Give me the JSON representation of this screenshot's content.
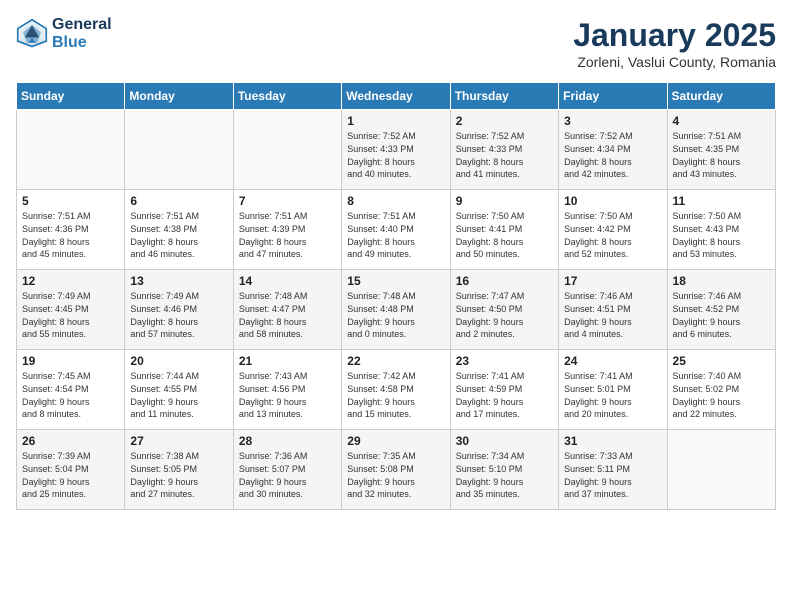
{
  "header": {
    "logo_line1": "General",
    "logo_line2": "Blue",
    "title": "January 2025",
    "subtitle": "Zorleni, Vaslui County, Romania"
  },
  "days_of_week": [
    "Sunday",
    "Monday",
    "Tuesday",
    "Wednesday",
    "Thursday",
    "Friday",
    "Saturday"
  ],
  "weeks": [
    [
      {
        "day": "",
        "info": ""
      },
      {
        "day": "",
        "info": ""
      },
      {
        "day": "",
        "info": ""
      },
      {
        "day": "1",
        "info": "Sunrise: 7:52 AM\nSunset: 4:33 PM\nDaylight: 8 hours\nand 40 minutes."
      },
      {
        "day": "2",
        "info": "Sunrise: 7:52 AM\nSunset: 4:33 PM\nDaylight: 8 hours\nand 41 minutes."
      },
      {
        "day": "3",
        "info": "Sunrise: 7:52 AM\nSunset: 4:34 PM\nDaylight: 8 hours\nand 42 minutes."
      },
      {
        "day": "4",
        "info": "Sunrise: 7:51 AM\nSunset: 4:35 PM\nDaylight: 8 hours\nand 43 minutes."
      }
    ],
    [
      {
        "day": "5",
        "info": "Sunrise: 7:51 AM\nSunset: 4:36 PM\nDaylight: 8 hours\nand 45 minutes."
      },
      {
        "day": "6",
        "info": "Sunrise: 7:51 AM\nSunset: 4:38 PM\nDaylight: 8 hours\nand 46 minutes."
      },
      {
        "day": "7",
        "info": "Sunrise: 7:51 AM\nSunset: 4:39 PM\nDaylight: 8 hours\nand 47 minutes."
      },
      {
        "day": "8",
        "info": "Sunrise: 7:51 AM\nSunset: 4:40 PM\nDaylight: 8 hours\nand 49 minutes."
      },
      {
        "day": "9",
        "info": "Sunrise: 7:50 AM\nSunset: 4:41 PM\nDaylight: 8 hours\nand 50 minutes."
      },
      {
        "day": "10",
        "info": "Sunrise: 7:50 AM\nSunset: 4:42 PM\nDaylight: 8 hours\nand 52 minutes."
      },
      {
        "day": "11",
        "info": "Sunrise: 7:50 AM\nSunset: 4:43 PM\nDaylight: 8 hours\nand 53 minutes."
      }
    ],
    [
      {
        "day": "12",
        "info": "Sunrise: 7:49 AM\nSunset: 4:45 PM\nDaylight: 8 hours\nand 55 minutes."
      },
      {
        "day": "13",
        "info": "Sunrise: 7:49 AM\nSunset: 4:46 PM\nDaylight: 8 hours\nand 57 minutes."
      },
      {
        "day": "14",
        "info": "Sunrise: 7:48 AM\nSunset: 4:47 PM\nDaylight: 8 hours\nand 58 minutes."
      },
      {
        "day": "15",
        "info": "Sunrise: 7:48 AM\nSunset: 4:48 PM\nDaylight: 9 hours\nand 0 minutes."
      },
      {
        "day": "16",
        "info": "Sunrise: 7:47 AM\nSunset: 4:50 PM\nDaylight: 9 hours\nand 2 minutes."
      },
      {
        "day": "17",
        "info": "Sunrise: 7:46 AM\nSunset: 4:51 PM\nDaylight: 9 hours\nand 4 minutes."
      },
      {
        "day": "18",
        "info": "Sunrise: 7:46 AM\nSunset: 4:52 PM\nDaylight: 9 hours\nand 6 minutes."
      }
    ],
    [
      {
        "day": "19",
        "info": "Sunrise: 7:45 AM\nSunset: 4:54 PM\nDaylight: 9 hours\nand 8 minutes."
      },
      {
        "day": "20",
        "info": "Sunrise: 7:44 AM\nSunset: 4:55 PM\nDaylight: 9 hours\nand 11 minutes."
      },
      {
        "day": "21",
        "info": "Sunrise: 7:43 AM\nSunset: 4:56 PM\nDaylight: 9 hours\nand 13 minutes."
      },
      {
        "day": "22",
        "info": "Sunrise: 7:42 AM\nSunset: 4:58 PM\nDaylight: 9 hours\nand 15 minutes."
      },
      {
        "day": "23",
        "info": "Sunrise: 7:41 AM\nSunset: 4:59 PM\nDaylight: 9 hours\nand 17 minutes."
      },
      {
        "day": "24",
        "info": "Sunrise: 7:41 AM\nSunset: 5:01 PM\nDaylight: 9 hours\nand 20 minutes."
      },
      {
        "day": "25",
        "info": "Sunrise: 7:40 AM\nSunset: 5:02 PM\nDaylight: 9 hours\nand 22 minutes."
      }
    ],
    [
      {
        "day": "26",
        "info": "Sunrise: 7:39 AM\nSunset: 5:04 PM\nDaylight: 9 hours\nand 25 minutes."
      },
      {
        "day": "27",
        "info": "Sunrise: 7:38 AM\nSunset: 5:05 PM\nDaylight: 9 hours\nand 27 minutes."
      },
      {
        "day": "28",
        "info": "Sunrise: 7:36 AM\nSunset: 5:07 PM\nDaylight: 9 hours\nand 30 minutes."
      },
      {
        "day": "29",
        "info": "Sunrise: 7:35 AM\nSunset: 5:08 PM\nDaylight: 9 hours\nand 32 minutes."
      },
      {
        "day": "30",
        "info": "Sunrise: 7:34 AM\nSunset: 5:10 PM\nDaylight: 9 hours\nand 35 minutes."
      },
      {
        "day": "31",
        "info": "Sunrise: 7:33 AM\nSunset: 5:11 PM\nDaylight: 9 hours\nand 37 minutes."
      },
      {
        "day": "",
        "info": ""
      }
    ]
  ]
}
